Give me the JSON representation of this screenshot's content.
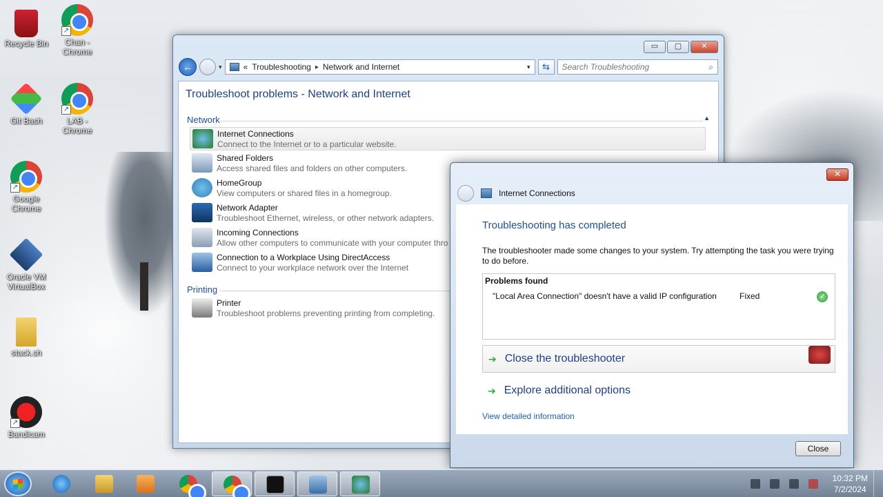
{
  "desktop": {
    "icons": [
      {
        "label": "Recycle Bin"
      },
      {
        "label": "Chan - Chrome"
      },
      {
        "label": "Git Bash"
      },
      {
        "label": "LAB - Chrome"
      },
      {
        "label": "Google Chrome"
      },
      {
        "label": "Oracle VM VirtualBox"
      },
      {
        "label": "stack.sh"
      },
      {
        "label": "Bandicam"
      }
    ]
  },
  "cp": {
    "back_glyph": "←",
    "address": {
      "overflow": "«",
      "crumbs": [
        "Troubleshooting",
        "Network and Internet"
      ],
      "sep": "▸",
      "dropdown": "▾"
    },
    "refresh": "⇆",
    "search_placeholder": "Search Troubleshooting",
    "search_icon": "⌕",
    "minimize": "▭",
    "maximize": "▢",
    "close": "✕",
    "title": "Troubleshoot problems - Network and Internet",
    "collapse": "▲",
    "sections": {
      "network": "Network",
      "printing": "Printing"
    },
    "items": [
      {
        "title": "Internet Connections",
        "desc": "Connect to the Internet or to a particular website."
      },
      {
        "title": "Shared Folders",
        "desc": "Access shared files and folders on other computers."
      },
      {
        "title": "HomeGroup",
        "desc": "View computers or shared files in a homegroup."
      },
      {
        "title": "Network Adapter",
        "desc": "Troubleshoot Ethernet, wireless, or other network adapters."
      },
      {
        "title": "Incoming Connections",
        "desc": "Allow other computers to communicate with your computer thro"
      },
      {
        "title": "Connection to a Workplace Using DirectAccess",
        "desc": "Connect to your workplace network over the Internet"
      },
      {
        "title": "Printer",
        "desc": "Troubleshoot problems preventing printing from completing."
      }
    ]
  },
  "ts": {
    "title": "Internet Connections",
    "close_x": "✕",
    "heading": "Troubleshooting has completed",
    "description": "The troubleshooter made some changes to your system. Try attempting the task you were trying to do before.",
    "problems_header": "Problems found",
    "problem": {
      "desc": "\"Local Area Connection\" doesn't have a valid IP configuration",
      "status": "Fixed",
      "check": "✓"
    },
    "arrow": "➔",
    "close_troubleshooter": "Close the troubleshooter",
    "explore": "Explore additional options",
    "detail_link": "View detailed information",
    "close_button": "Close"
  },
  "taskbar": {
    "time": "10:32 PM",
    "date": "7/2/2024"
  },
  "colors": {
    "accent": "#1e4f9c",
    "link": "#1e5fb8",
    "success": "#2eaa2e"
  }
}
